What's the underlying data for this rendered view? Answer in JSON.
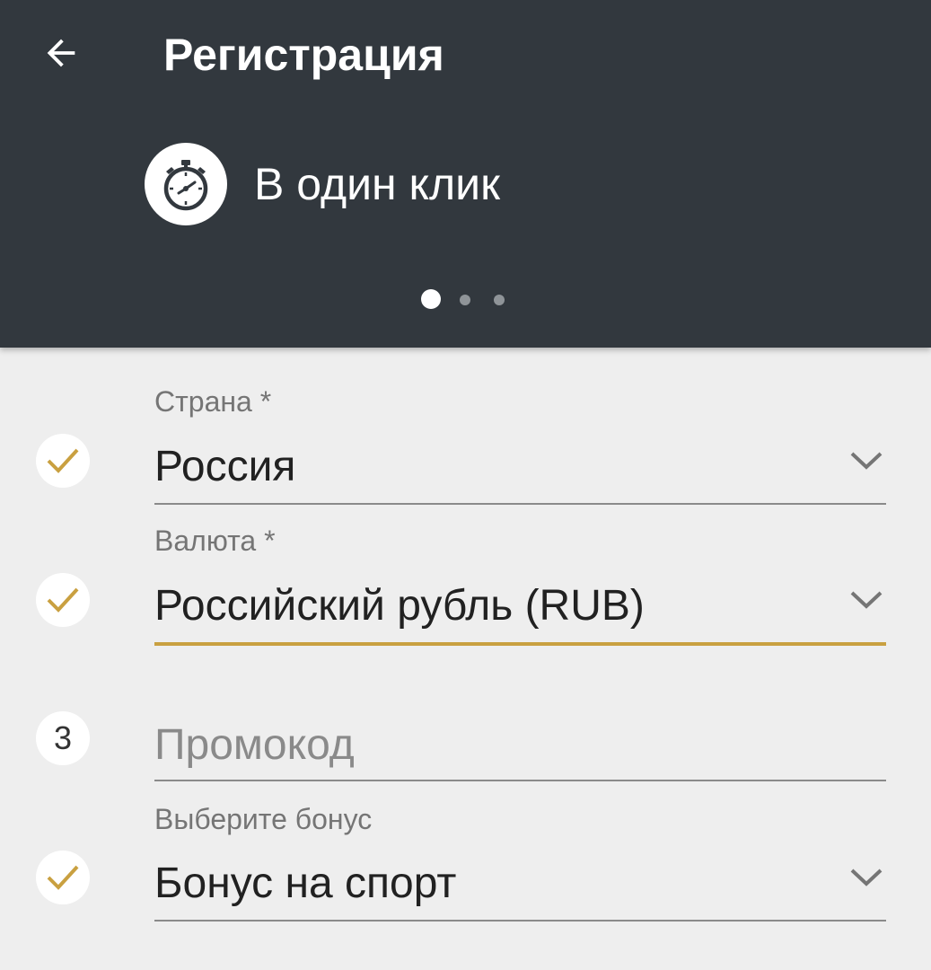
{
  "header": {
    "title": "Регистрация",
    "back_icon": "arrow-left-icon",
    "mode_icon": "stopwatch-icon",
    "mode_label": "В один клик",
    "pager": {
      "pages": 3,
      "active_page": 1
    },
    "background_color": "#32383e"
  },
  "form": {
    "country": {
      "label": "Страна *",
      "value": "Россия",
      "status": "done"
    },
    "currency": {
      "label": "Валюта *",
      "value": "Российский рубль (RUB)",
      "status": "done",
      "focused": true
    },
    "promo": {
      "step": "3",
      "placeholder": "Промокод",
      "value": ""
    },
    "bonus": {
      "label": "Выберите бонус",
      "value": "Бонус на спорт",
      "status": "done"
    }
  },
  "colors": {
    "accent": "#c9a040",
    "background": "#eeeeee",
    "text": "#212121",
    "secondary_text": "#757575"
  }
}
